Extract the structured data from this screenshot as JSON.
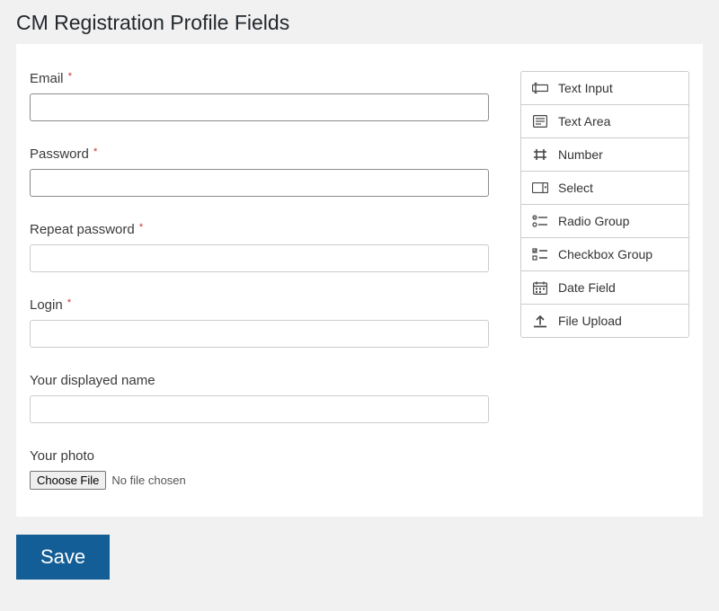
{
  "page": {
    "title": "CM Registration Profile Fields"
  },
  "form": {
    "fields": [
      {
        "label": "Email",
        "required": true,
        "type": "text",
        "enabled": true
      },
      {
        "label": "Password",
        "required": true,
        "type": "text",
        "enabled": true
      },
      {
        "label": "Repeat password",
        "required": true,
        "type": "text",
        "enabled": false
      },
      {
        "label": "Login",
        "required": true,
        "type": "text",
        "enabled": false
      },
      {
        "label": "Your displayed name",
        "required": false,
        "type": "text",
        "enabled": false
      },
      {
        "label": "Your photo",
        "required": false,
        "type": "file"
      }
    ],
    "file_button_label": "Choose File",
    "file_status": "No file chosen",
    "required_marker": "*"
  },
  "palette": {
    "items": [
      {
        "label": "Text Input",
        "icon": "text-input-icon"
      },
      {
        "label": "Text Area",
        "icon": "text-area-icon"
      },
      {
        "label": "Number",
        "icon": "number-icon"
      },
      {
        "label": "Select",
        "icon": "select-icon"
      },
      {
        "label": "Radio Group",
        "icon": "radio-group-icon"
      },
      {
        "label": "Checkbox Group",
        "icon": "checkbox-group-icon"
      },
      {
        "label": "Date Field",
        "icon": "date-field-icon"
      },
      {
        "label": "File Upload",
        "icon": "file-upload-icon"
      }
    ]
  },
  "actions": {
    "save_label": "Save"
  }
}
